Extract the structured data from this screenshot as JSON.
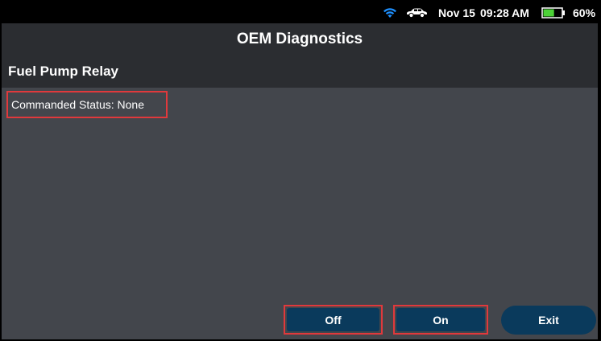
{
  "status_bar": {
    "wifi_icon": "wifi-icon",
    "car_icon": "car-icon",
    "date": "Nov 15",
    "time": "09:28 AM",
    "battery_icon": "battery-icon",
    "battery_percent": "60%",
    "battery_level": 0.6,
    "wifi_color": "#1e90ff",
    "battery_color": "#4cd137"
  },
  "header": {
    "title": "OEM Diagnostics"
  },
  "section": {
    "title": "Fuel Pump Relay"
  },
  "content": {
    "commanded_status": "Commanded Status: None"
  },
  "buttons": {
    "off_label": "Off",
    "on_label": "On",
    "exit_label": "Exit"
  },
  "colors": {
    "highlight_border": "#e0393c",
    "button_bg": "#0a3a5c",
    "content_bg": "#43464c",
    "header_bg": "#2b2d31"
  }
}
